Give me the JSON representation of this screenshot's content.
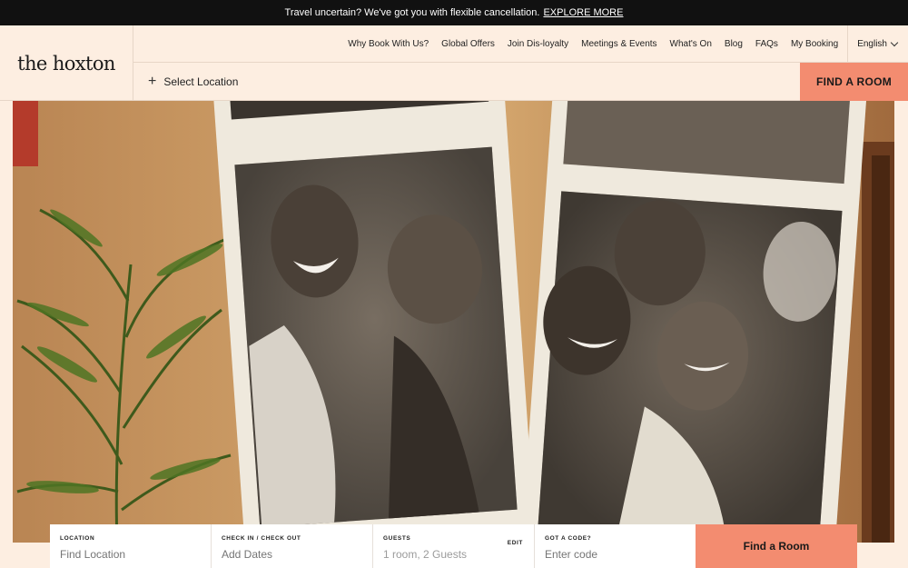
{
  "announcement": {
    "text": "Travel uncertain? We've got you with flexible cancellation.",
    "link": "EXPLORE MORE"
  },
  "brand": {
    "logo": "the hoxton"
  },
  "nav": {
    "items": [
      "Why Book With Us?",
      "Global Offers",
      "Join Dis-loyalty",
      "Meetings & Events",
      "What's On",
      "Blog",
      "FAQs",
      "My Booking"
    ],
    "language": "English"
  },
  "header": {
    "select_location": "Select Location",
    "find_room": "FIND A ROOM"
  },
  "booking": {
    "location_label": "LOCATION",
    "location_placeholder": "Find Location",
    "dates_label": "CHECK IN / CHECK OUT",
    "dates_placeholder": "Add Dates",
    "guests_label": "GUESTS",
    "guests_value": "1 room, 2 Guests",
    "guests_edit": "EDIT",
    "code_label": "GOT A CODE?",
    "code_placeholder": "Enter code",
    "submit": "Find a Room"
  },
  "colors": {
    "accent": "#f38c70",
    "background": "#fdeee1",
    "topbar": "#111111"
  },
  "icons": {
    "plus": "plus-icon",
    "language_chevron": "chevron-down-icon"
  }
}
